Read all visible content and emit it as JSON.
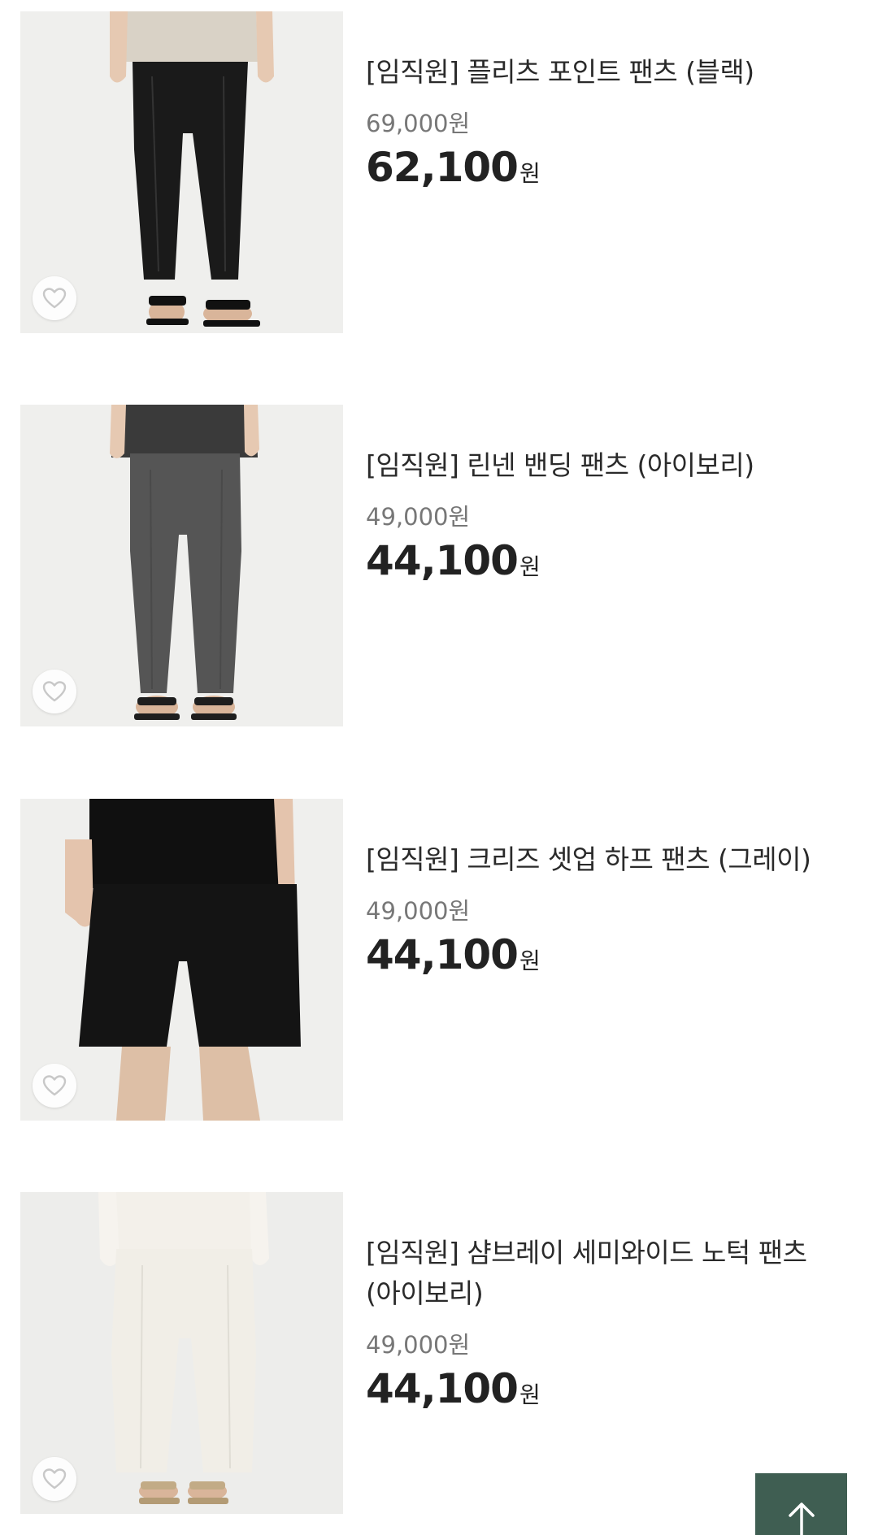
{
  "products": [
    {
      "name": "[임직원] 플리츠 포인트 팬츠 (블랙)",
      "original_price": "69,000원",
      "sale_price": "62,100",
      "sale_unit": "원"
    },
    {
      "name": "[임직원] 린넨 밴딩 팬츠 (아이보리)",
      "original_price": "49,000원",
      "sale_price": "44,100",
      "sale_unit": "원"
    },
    {
      "name": "[임직원] 크리즈 셋업 하프 팬츠 (그레이)",
      "original_price": "49,000원",
      "sale_price": "44,100",
      "sale_unit": "원"
    },
    {
      "name_line1": "[임직원] 샴브레이 세미와이드 노턱 팬츠",
      "name_line2": "(아이보리)",
      "original_price": "49,000원",
      "sale_price": "44,100",
      "sale_unit": "원"
    }
  ],
  "icons": {
    "wishlist": "heart-icon",
    "scroll_top": "arrow-up-icon"
  },
  "colors": {
    "top_button": "#3f5e52",
    "original_price": "#777777",
    "thumb_background": "#eeeeed"
  }
}
